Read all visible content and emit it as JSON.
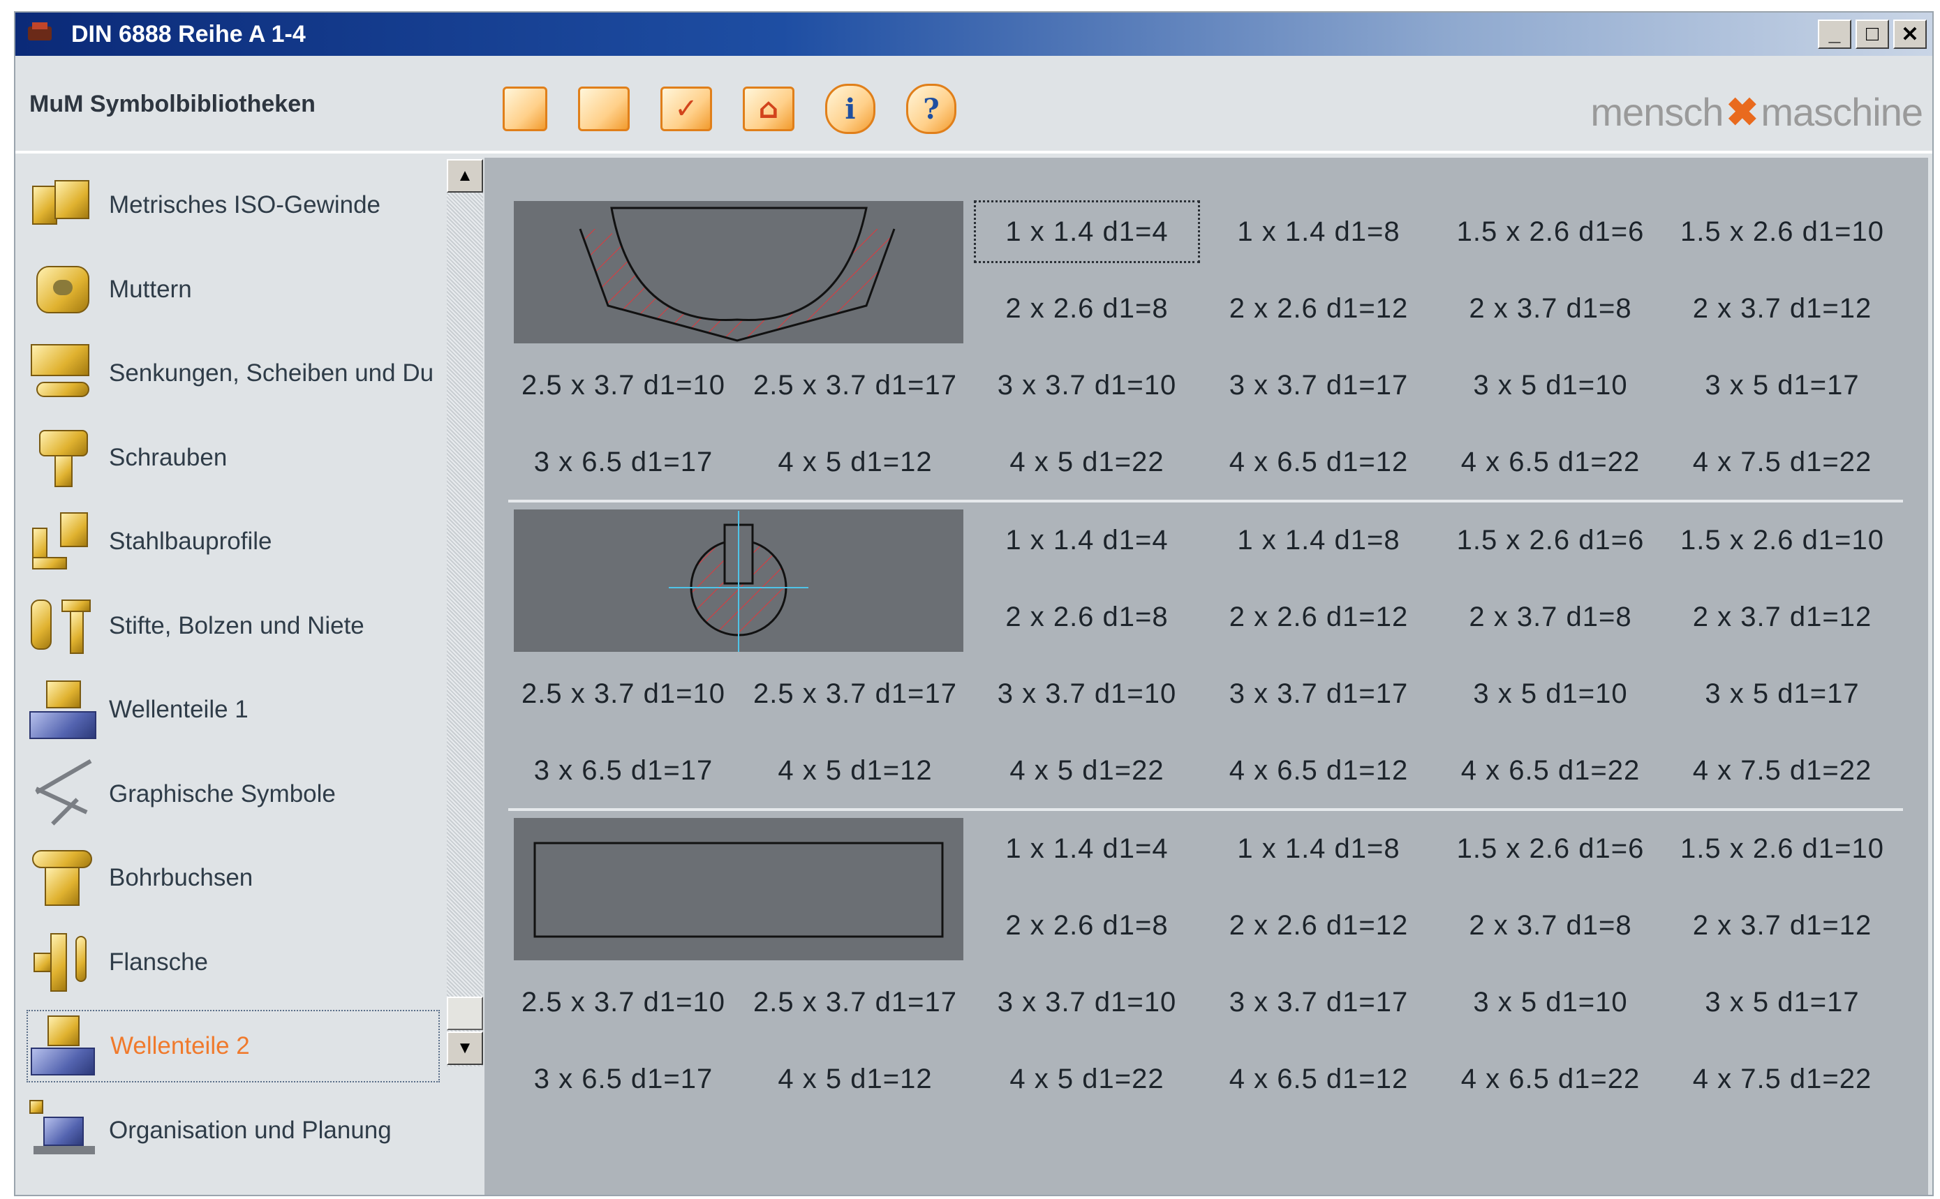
{
  "window": {
    "title": "DIN 6888 Reihe A 1-4",
    "controls": [
      "_",
      "□",
      "✕"
    ]
  },
  "header": {
    "library_title": "MuM Symbolbibliotheken",
    "brand_left": "mensch",
    "brand_mark": "✖",
    "brand_right": "maschine",
    "toolbar": [
      {
        "name": "new-icon",
        "glyph": ""
      },
      {
        "name": "panel-icon",
        "glyph": ""
      },
      {
        "name": "check-icon",
        "glyph": "✓"
      },
      {
        "name": "insert-icon",
        "glyph": "⌂"
      },
      {
        "name": "info-icon",
        "glyph": "i"
      },
      {
        "name": "help-icon",
        "glyph": "?"
      }
    ]
  },
  "sidebar": {
    "items": [
      {
        "label": "Metrisches ISO-Gewinde",
        "icon": "thread-icon"
      },
      {
        "label": "Muttern",
        "icon": "nut-icon"
      },
      {
        "label": "Senkungen, Scheiben und Du",
        "icon": "washer-icon"
      },
      {
        "label": "Schrauben",
        "icon": "screw-icon"
      },
      {
        "label": "Stahlbauprofile",
        "icon": "steel-profile-icon"
      },
      {
        "label": "Stifte, Bolzen und Niete",
        "icon": "pin-icon"
      },
      {
        "label": "Wellenteile 1",
        "icon": "shaft-parts-icon"
      },
      {
        "label": "Graphische Symbole",
        "icon": "graphic-symbols-icon"
      },
      {
        "label": "Bohrbuchsen",
        "icon": "drill-bushing-icon"
      },
      {
        "label": "Flansche",
        "icon": "flange-icon"
      },
      {
        "label": "Wellenteile 2",
        "icon": "shaft-parts-2-icon",
        "active": true
      },
      {
        "label": "Organisation und Planung",
        "icon": "organisation-icon"
      }
    ],
    "scroll_up": "▲",
    "scroll_down": "▼"
  },
  "groups": [
    {
      "preview": "key-side-view",
      "row1": [
        "1 x 1.4 d1=4",
        "1 x 1.4 d1=8",
        "1.5 x 2.6 d1=6",
        "1.5 x 2.6 d1=10"
      ],
      "row2": [
        "2 x 2.6 d1=8",
        "2 x 2.6 d1=12",
        "2 x 3.7 d1=8",
        "2 x 3.7 d1=12"
      ],
      "row3": [
        "2.5 x 3.7 d1=10",
        "2.5 x 3.7 d1=17",
        "3 x 3.7 d1=10",
        "3 x 3.7 d1=17",
        "3 x 5 d1=10",
        "3 x 5 d1=17"
      ],
      "row4": [
        "3 x 6.5 d1=17",
        "4 x 5 d1=12",
        "4 x 5 d1=22",
        "4 x 6.5 d1=12",
        "4 x 6.5 d1=22",
        "4 x 7.5 d1=22"
      ]
    },
    {
      "preview": "key-section-view",
      "row1": [
        "1 x 1.4 d1=4",
        "1 x 1.4 d1=8",
        "1.5 x 2.6 d1=6",
        "1.5 x 2.6 d1=10"
      ],
      "row2": [
        "2 x 2.6 d1=8",
        "2 x 2.6 d1=12",
        "2 x 3.7 d1=8",
        "2 x 3.7 d1=12"
      ],
      "row3": [
        "2.5 x 3.7 d1=10",
        "2.5 x 3.7 d1=17",
        "3 x 3.7 d1=10",
        "3 x 3.7 d1=17",
        "3 x 5 d1=10",
        "3 x 5 d1=17"
      ],
      "row4": [
        "3 x 6.5 d1=17",
        "4 x 5 d1=12",
        "4 x 5 d1=22",
        "4 x 6.5 d1=12",
        "4 x 6.5 d1=22",
        "4 x 7.5 d1=22"
      ]
    },
    {
      "preview": "key-top-view",
      "row1": [
        "1 x 1.4 d1=4",
        "1 x 1.4 d1=8",
        "1.5 x 2.6 d1=6",
        "1.5 x 2.6 d1=10"
      ],
      "row2": [
        "2 x 2.6 d1=8",
        "2 x 2.6 d1=12",
        "2 x 3.7 d1=8",
        "2 x 3.7 d1=12"
      ],
      "row3": [
        "2.5 x 3.7 d1=10",
        "2.5 x 3.7 d1=17",
        "3 x 3.7 d1=10",
        "3 x 3.7 d1=17",
        "3 x 5 d1=10",
        "3 x 5 d1=17"
      ],
      "row4": [
        "3 x 6.5 d1=17",
        "4 x 5 d1=12",
        "4 x 5 d1=22",
        "4 x 6.5 d1=12",
        "4 x 6.5 d1=22",
        "4 x 7.5 d1=22"
      ]
    }
  ],
  "colors": {
    "accent": "#f07a2c",
    "content_bg": "#aeb4ba",
    "preview_bg": "#6b6f74",
    "hatch": "#e0383c",
    "centerline": "#4fc3e8"
  }
}
